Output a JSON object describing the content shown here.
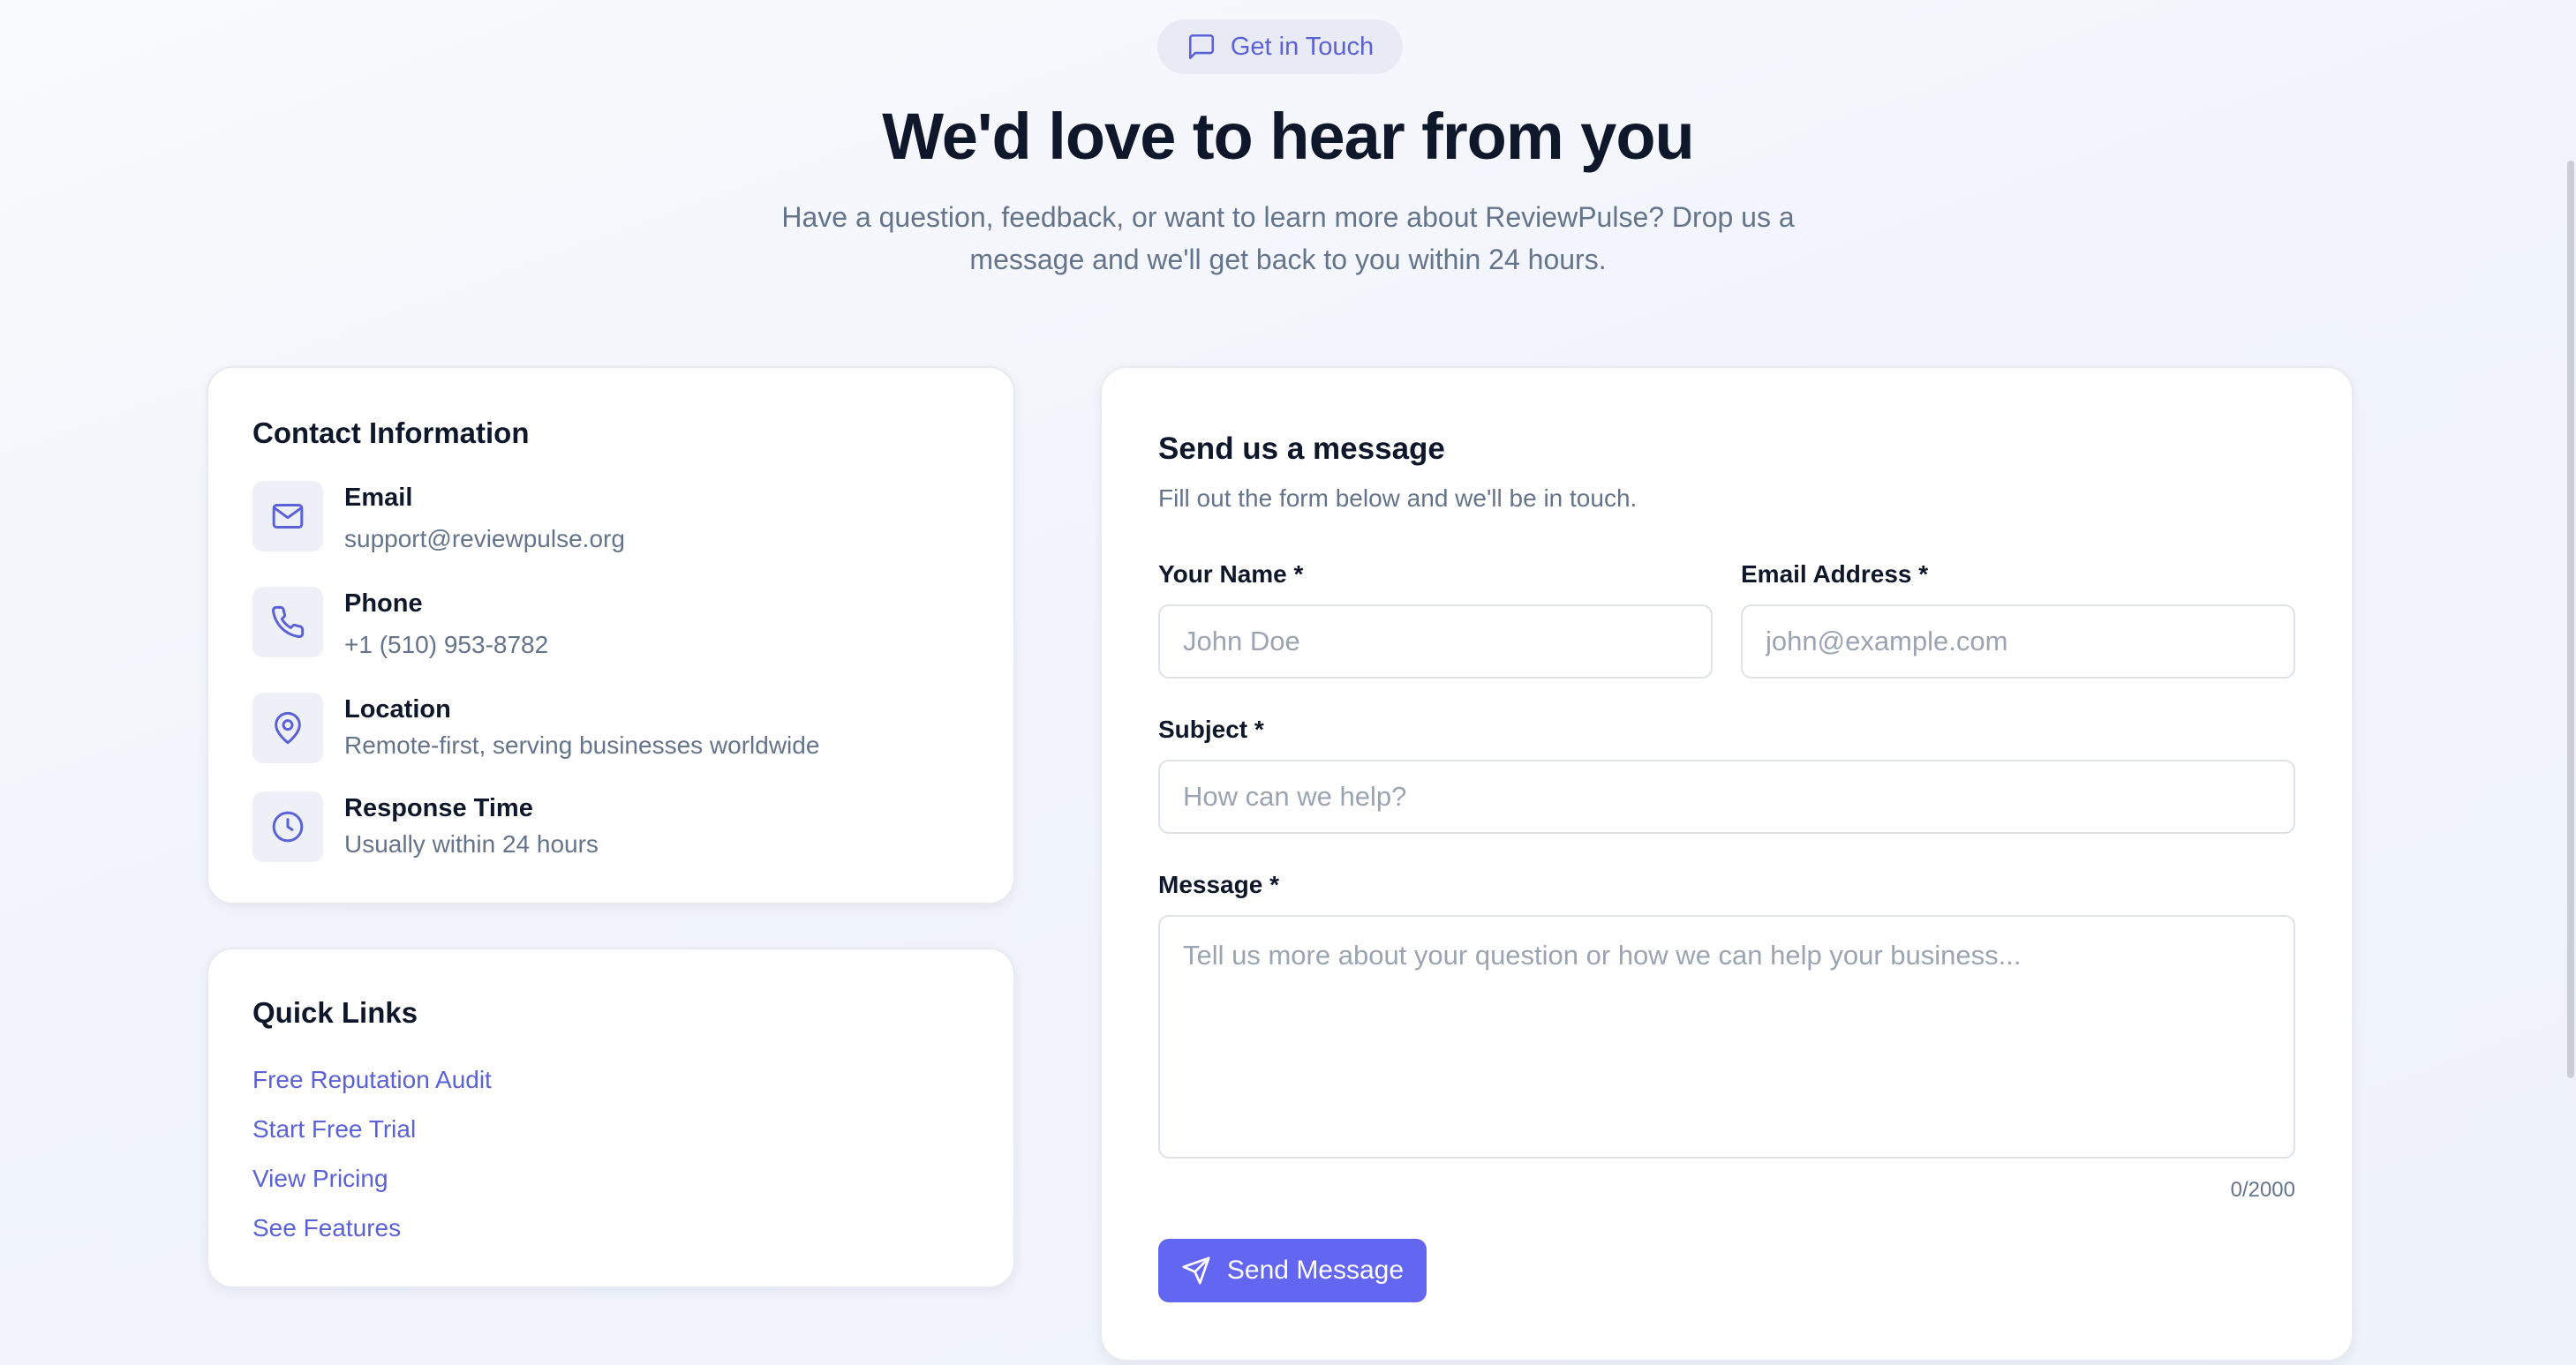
{
  "header": {
    "badge_label": "Get in Touch",
    "badge_icon": "message-square-icon",
    "title": "We'd love to hear from you",
    "subtitle": "Have a question, feedback, or want to learn more about ReviewPulse? Drop us a message and we'll get back to you within 24 hours."
  },
  "contact": {
    "title": "Contact Information",
    "items": [
      {
        "icon": "mail-icon",
        "label": "Email",
        "value": "support@reviewpulse.org"
      },
      {
        "icon": "phone-icon",
        "label": "Phone",
        "value": "+1 (510) 953-8782"
      },
      {
        "icon": "map-pin-icon",
        "label": "Location",
        "value": "Remote-first, serving businesses worldwide"
      },
      {
        "icon": "clock-icon",
        "label": "Response Time",
        "value": "Usually within 24 hours"
      }
    ]
  },
  "quick_links": {
    "title": "Quick Links",
    "items": [
      "Free Reputation Audit",
      "Start Free Trial",
      "View Pricing",
      "See Features"
    ]
  },
  "form": {
    "title": "Send us a message",
    "subtitle": "Fill out the form below and we'll be in touch.",
    "name_label": "Your Name *",
    "name_placeholder": "John Doe",
    "email_label": "Email Address *",
    "email_placeholder": "john@example.com",
    "subject_label": "Subject *",
    "subject_placeholder": "How can we help?",
    "message_label": "Message *",
    "message_placeholder": "Tell us more about your question or how we can help your business...",
    "counter": "0/2000",
    "submit_label": "Send Message"
  },
  "colors": {
    "accent": "#6366f1",
    "link": "#5a62d6",
    "heading": "#0f172a",
    "muted": "#64748b",
    "badge_bg": "#e8eaf6"
  }
}
